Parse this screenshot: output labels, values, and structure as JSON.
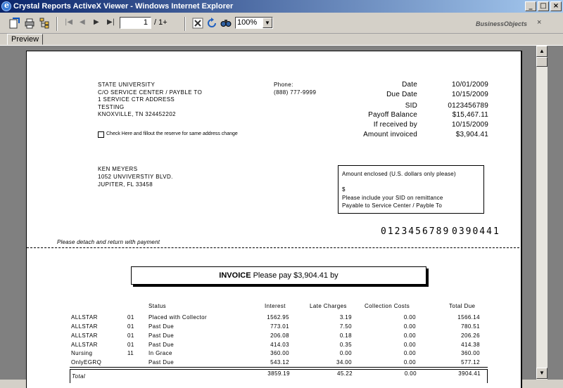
{
  "window": {
    "title": "Crystal Reports ActiveX Viewer - Windows Internet Explorer"
  },
  "toolbar": {
    "page_value": "1",
    "page_total": "/ 1+",
    "zoom": "100%",
    "brand": "BusinessObjects"
  },
  "tab": {
    "label": "Preview"
  },
  "sender": {
    "lines": [
      "STATE UNIVERSITY",
      "C/O SERVICE CENTER / PAYBLE TO",
      "1 SERVICE CTR ADDRESS",
      "TESTING",
      "KNOXVILLE, TN 324452202"
    ],
    "phone_label": "Phone:",
    "phone": "(888) 777-9999"
  },
  "summary": [
    {
      "label": "Date",
      "value": "10/01/2009"
    },
    {
      "label": "Due Date",
      "value": "10/15/2009"
    },
    {
      "label": "SID",
      "value": "0123456789"
    },
    {
      "label": "Payoff Balance",
      "value": "$15,467.11"
    },
    {
      "label": "If received by",
      "value": "10/15/2009"
    },
    {
      "label": "Amount invoiced",
      "value": "$3,904.41"
    }
  ],
  "address_change": "Check Here and fillout the reserve for same address change",
  "recipient": [
    "KEN MEYERS",
    "1052 UNVIVERSTIY BLVD.",
    "JUPITER, FL 33458"
  ],
  "remit": {
    "heading": "Amount enclosed (U.S. dollars only please)",
    "currency": "$",
    "line1": "Please include your SID on remittance",
    "line2": "Payable to Service Center / Payble To"
  },
  "barcode": {
    "sid": "0123456789",
    "amount": "0390441"
  },
  "detach_note": "Please detach and return with payment",
  "invoice": {
    "bold": "INVOICE",
    "text": "Please pay $3,904.41 by"
  },
  "table": {
    "headers": [
      "Status",
      "Interest",
      "Late Charges",
      "Collection Costs",
      "Total Due"
    ],
    "rows": [
      [
        "ALLSTAR",
        "01",
        "Placed with Collector",
        "1562.95",
        "3.19",
        "0.00",
        "1566.14"
      ],
      [
        "ALLSTAR",
        "01",
        "Past Due",
        "773.01",
        "7.50",
        "0.00",
        "780.51"
      ],
      [
        "ALLSTAR",
        "01",
        "Past Due",
        "206.08",
        "0.18",
        "0.00",
        "206.26"
      ],
      [
        "ALLSTAR",
        "01",
        "Past Due",
        "414.03",
        "0.35",
        "0.00",
        "414.38"
      ],
      [
        "Nursing",
        "11",
        "In Grace",
        "360.00",
        "0.00",
        "0.00",
        "360.00"
      ],
      [
        "OnlyEGRQ",
        "",
        "Past Due",
        "543.12",
        "34.00",
        "0.00",
        "577.12"
      ]
    ],
    "total": [
      "Total",
      "3859.19",
      "45.22",
      "0.00",
      "3904.41"
    ]
  }
}
